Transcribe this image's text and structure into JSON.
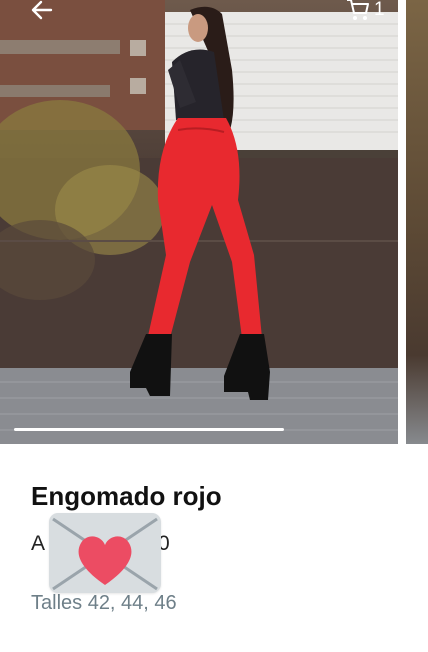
{
  "header": {
    "back_icon": "arrow-left-icon",
    "cart_icon": "shopping-cart-icon",
    "cart_count": "1"
  },
  "gallery": {
    "progress": 0.65
  },
  "product": {
    "title": "Engomado rojo",
    "price_prefix": "A",
    "price_suffix": "0",
    "sizes": "Talles 42, 44, 46"
  },
  "overlay": {
    "icon": "heart-envelope-icon",
    "heart_color": "#ec4c63",
    "envelope_color": "#d8dde0"
  }
}
